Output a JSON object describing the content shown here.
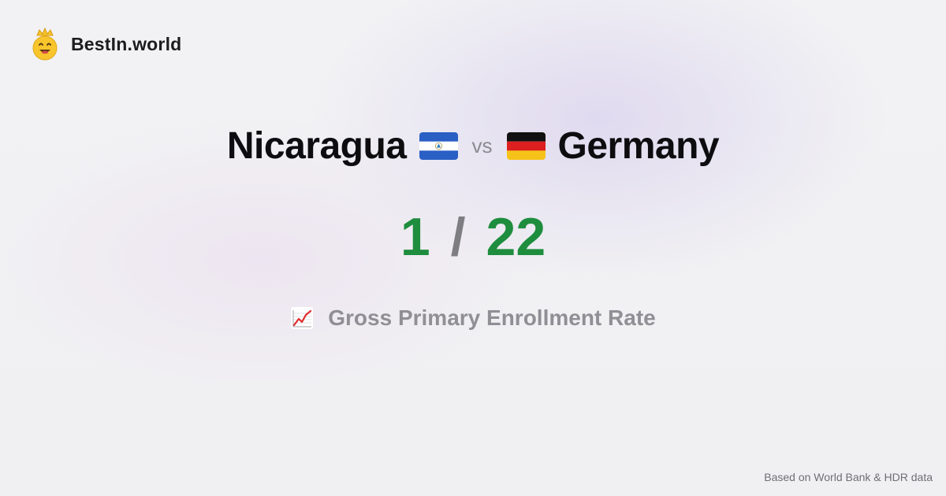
{
  "brand": {
    "name": "BestIn.world",
    "logo_icon": "crowned-smiley-icon"
  },
  "comparison": {
    "left_country": "Nicaragua",
    "left_flag": "nicaragua-flag-icon",
    "vs_label": "vs",
    "right_country": "Germany",
    "right_flag": "germany-flag-icon",
    "left_score": "1",
    "separator": "/",
    "right_score": "22"
  },
  "metric": {
    "icon": "chart-increasing-icon",
    "label": "Gross Primary Enrollment Rate"
  },
  "footer": {
    "source": "Based on World Bank & HDR data"
  },
  "colors": {
    "score_green": "#1e8d3e",
    "nicaragua_blue": "#2a5fc4",
    "germany_black": "#111111",
    "germany_red": "#dd1f1f",
    "germany_gold": "#f6c21a"
  }
}
